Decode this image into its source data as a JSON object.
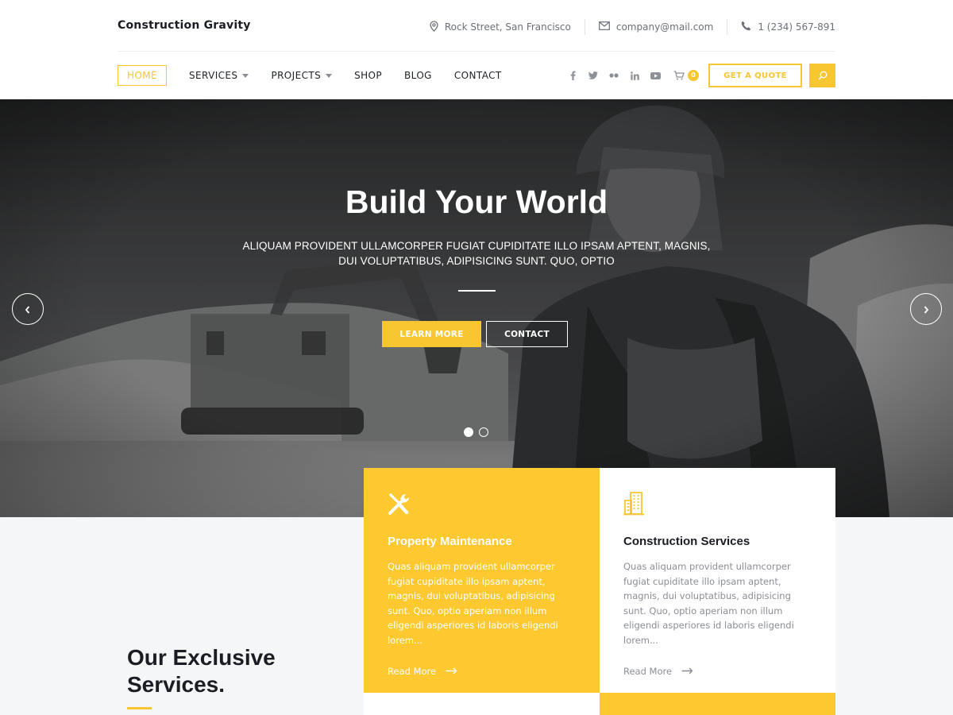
{
  "site": {
    "brand": "Construction Gravity"
  },
  "contact_bar": {
    "address": "Rock Street, San Francisco",
    "email": "company@mail.com",
    "phone": "1 (234) 567-891"
  },
  "nav": {
    "items": [
      {
        "label": "HOME",
        "active": true,
        "has_dropdown": false
      },
      {
        "label": "SERVICES",
        "active": false,
        "has_dropdown": true
      },
      {
        "label": "PROJECTS",
        "active": false,
        "has_dropdown": true
      },
      {
        "label": "SHOP",
        "active": false,
        "has_dropdown": false
      },
      {
        "label": "BLOG",
        "active": false,
        "has_dropdown": false
      },
      {
        "label": "CONTACT",
        "active": false,
        "has_dropdown": false
      }
    ],
    "social_icons": [
      "facebook-icon",
      "twitter-icon",
      "flickr-icon",
      "linkedin-icon",
      "youtube-icon"
    ],
    "cart_count": "0",
    "quote_label": "GET A QUOTE"
  },
  "hero": {
    "title": "Build Your World",
    "subtitle_line1": "ALIQUAM PROVIDENT ULLAMCORPER FUGIAT CUPIDITATE ILLO IPSAM APTENT, MAGNIS,",
    "subtitle_line2": "DUI VOLUPTATIBUS, ADIPISICING SUNT. QUO, OPTIO",
    "primary_button": "LEARN MORE",
    "secondary_button": "CONTACT",
    "slide_count": 2,
    "active_slide": 1
  },
  "services": {
    "heading_line1": "Our Exclusive",
    "heading_line2": "Services.",
    "cards": [
      {
        "icon": "tools-icon",
        "title": "Property Maintenance",
        "text": [
          "Quas aliquam provident ullamcorper",
          "fugiat cupiditate illo ipsam aptent,",
          "magnis, dui voluptatibus, adipisicing",
          "sunt. Quo, optio aperiam non illum",
          "eligendi asperiores id laboris eligendi",
          "lorem..."
        ],
        "link": "Read More"
      },
      {
        "icon": "building-icon",
        "title": "Construction Services",
        "text": [
          "Quas aliquam provident ullamcorper",
          "fugiat cupiditate illo ipsam aptent,",
          "magnis, dui voluptatibus, adipisicing",
          "sunt. Quo, optio aperiam non illum",
          "eligendi asperiores id laboris eligendi",
          "lorem..."
        ],
        "link": "Read More"
      }
    ]
  },
  "colors": {
    "accent": "#f8c630",
    "card_yellow": "#fec930",
    "text_dark": "#1a1d23",
    "text_muted": "#8b8e95"
  }
}
